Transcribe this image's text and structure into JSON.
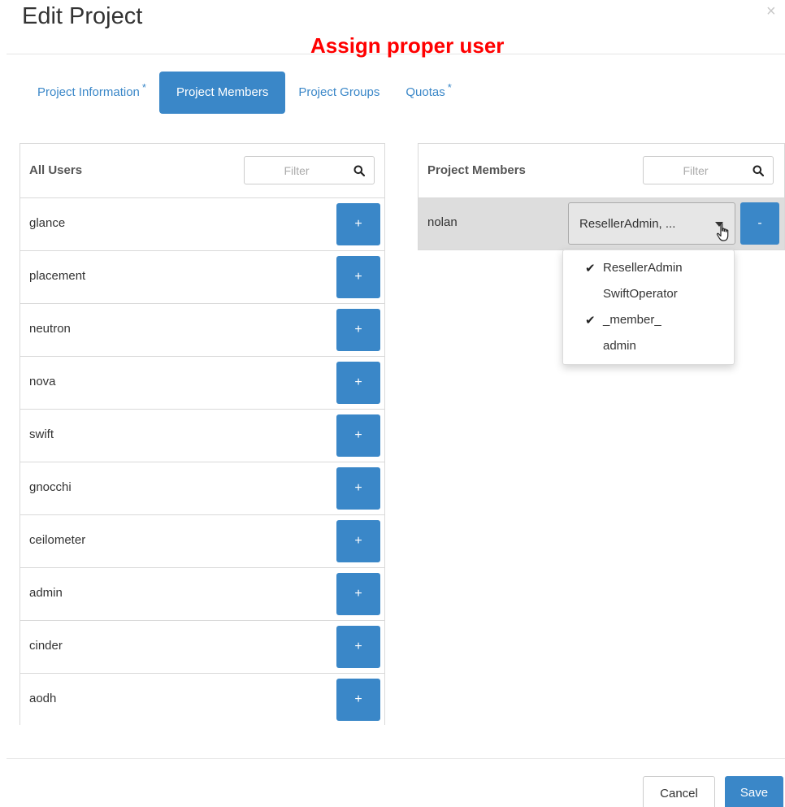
{
  "modal": {
    "title": "Edit Project",
    "close_symbol": "×",
    "annotation": "Assign proper user"
  },
  "tabs": [
    {
      "label": "Project Information",
      "required_mark": "*",
      "active": false
    },
    {
      "label": "Project Members",
      "required_mark": "",
      "active": true
    },
    {
      "label": "Project Groups",
      "required_mark": "",
      "active": false
    },
    {
      "label": "Quotas",
      "required_mark": "*",
      "active": false
    }
  ],
  "all_users": {
    "title": "All Users",
    "filter_placeholder": "Filter",
    "add_label": "+",
    "users": [
      "glance",
      "placement",
      "neutron",
      "nova",
      "swift",
      "gnocchi",
      "ceilometer",
      "admin",
      "cinder",
      "aodh"
    ]
  },
  "project_members": {
    "title": "Project Members",
    "filter_placeholder": "Filter",
    "remove_label": "-",
    "members": [
      {
        "name": "nolan",
        "roles_display": "ResellerAdmin,  ..."
      }
    ]
  },
  "role_menu": {
    "items": [
      {
        "label": "ResellerAdmin",
        "checked": true
      },
      {
        "label": "SwiftOperator",
        "checked": false
      },
      {
        "label": "_member_",
        "checked": true
      },
      {
        "label": "admin",
        "checked": false
      }
    ]
  },
  "footer": {
    "cancel_label": "Cancel",
    "save_label": "Save"
  },
  "icons": {
    "search": "search-icon",
    "close": "close-icon",
    "check": "check-icon",
    "caret": "caret-down-icon",
    "cursor": "hand-cursor-icon"
  },
  "colors": {
    "primary": "#3a87c8",
    "annotation": "#ff0000",
    "member_row_bg": "#dddddd"
  }
}
